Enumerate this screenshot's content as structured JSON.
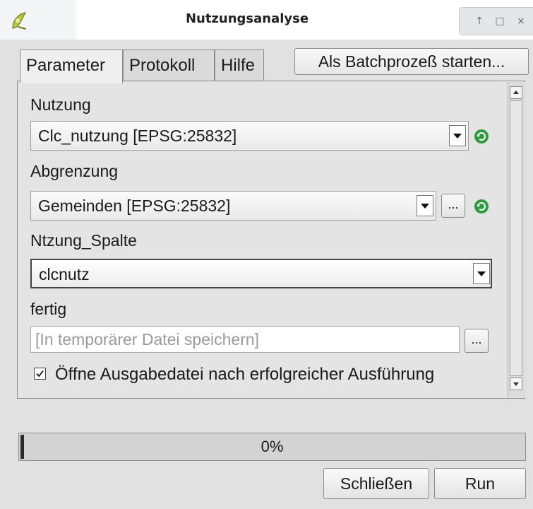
{
  "window": {
    "title": "Nutzungsanalyse",
    "buttons": {
      "up": "↑",
      "maximize": "□",
      "close": "×"
    }
  },
  "tabs": [
    {
      "label": "Parameter",
      "active": true
    },
    {
      "label": "Protokoll",
      "active": false
    },
    {
      "label": "Hilfe",
      "active": false
    }
  ],
  "toolbar": {
    "batch_label": "Als Batchprozeß starten..."
  },
  "form": {
    "nutzung": {
      "label": "Nutzung",
      "value": "Clc_nutzung [EPSG:25832]"
    },
    "abgrenzung": {
      "label": "Abgrenzung",
      "value": "Gemeinden [EPSG:25832]",
      "browse": "..."
    },
    "spalte": {
      "label": "Ntzung_Spalte",
      "value": "clcnutz"
    },
    "output": {
      "label": "fertig",
      "placeholder": "[In temporärer Datei speichern]",
      "browse": "..."
    },
    "open_after": {
      "label": "Öffne Ausgabedatei nach erfolgreicher Ausführung",
      "checked": true
    }
  },
  "progress": {
    "text": "0%",
    "value": 0
  },
  "footer": {
    "close_label": "Schließen",
    "run_label": "Run"
  },
  "colors": {
    "progress_fill": "#3a7bd5",
    "refresh_icon": "#2e9b3e"
  },
  "icons": [
    "qgis-logo-icon",
    "refresh-icon",
    "chevron-down-icon",
    "checkbox-icon"
  ]
}
